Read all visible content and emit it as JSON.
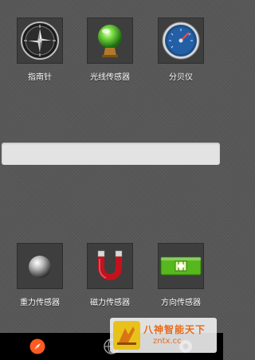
{
  "sensors_top": [
    {
      "label": "指南针",
      "icon": "compass-icon"
    },
    {
      "label": "光线传感器",
      "icon": "green-orb-icon"
    },
    {
      "label": "分贝仪",
      "icon": "decibel-gauge-icon"
    }
  ],
  "sensors_bottom": [
    {
      "label": "重力传感器",
      "icon": "steel-ball-icon"
    },
    {
      "label": "磁力传感器",
      "icon": "magnet-icon"
    },
    {
      "label": "方向传感器",
      "icon": "level-bubble-icon"
    }
  ],
  "navbar": {
    "tabs": [
      {
        "icon": "compass-nav-icon",
        "active": true
      },
      {
        "icon": "globe-nav-icon",
        "active": false
      },
      {
        "icon": "settings-nav-icon",
        "active": false
      }
    ]
  },
  "watermark": {
    "name": "八神智能天下",
    "url": "zntx.cc"
  },
  "colors": {
    "accent_active": "#ff5a1f",
    "watermark_text": "#e56a1c"
  }
}
